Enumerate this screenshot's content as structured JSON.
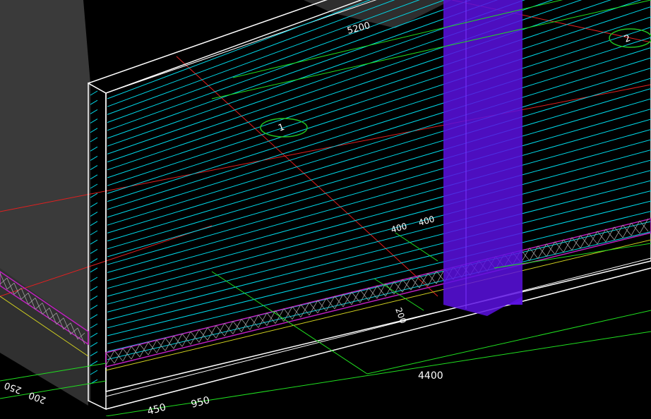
{
  "viewport": {
    "background": "#000000",
    "colors": {
      "wall_edge": "#ffffff",
      "rebar_lines": "#00d8e8",
      "axis_line": "#e02020",
      "dimension": "#20e020",
      "dimension_text": "#ffffff",
      "hatch": "#a0a0a0",
      "magenta_band": "#c020c0",
      "column_fill": "#5a10e0",
      "grid_bubble": "#20c020",
      "yellow_line": "#d0d020",
      "gray_block": "#3c3c3c"
    }
  },
  "grid_bubbles": [
    {
      "label": "1"
    },
    {
      "label": "2"
    }
  ],
  "dimensions": {
    "top_length": "5200",
    "offset_a": "400",
    "offset_b": "400",
    "bottom_mid": "200",
    "bottom_length": "4400",
    "bottom_left_a": "450",
    "bottom_left_b": "950",
    "left_a": "250",
    "left_b": "200"
  }
}
